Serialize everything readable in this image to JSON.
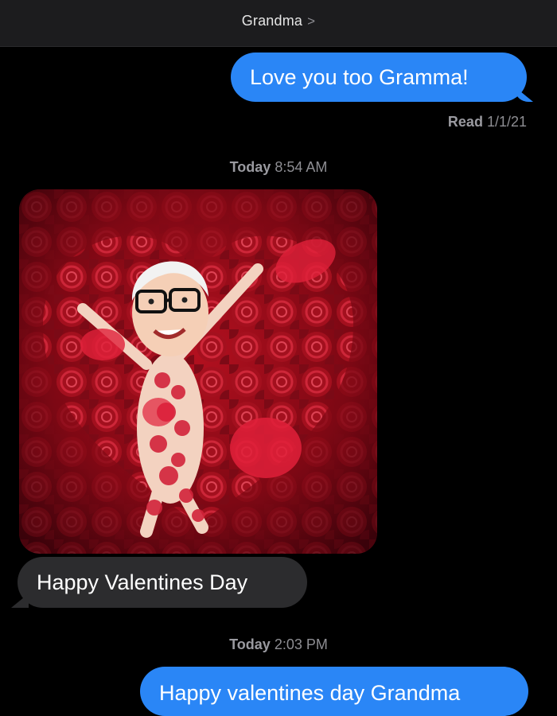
{
  "header": {
    "contact_name": "Grandma",
    "chevron_icon": "chevron-right-icon"
  },
  "messages": [
    {
      "type": "sent",
      "text": "Love you too Gramma!"
    },
    {
      "type": "status",
      "label": "Read",
      "date": "1/1/21"
    },
    {
      "type": "timestamp",
      "day": "Today",
      "time": "8:54 AM"
    },
    {
      "type": "received-image",
      "alt": ""
    },
    {
      "type": "received",
      "text": "Happy Valentines Day"
    },
    {
      "type": "timestamp",
      "day": "Today",
      "time": "2:03 PM"
    },
    {
      "type": "sent",
      "text": "Happy valentines day Grandma"
    }
  ],
  "colors": {
    "background": "#000000",
    "sent_bubble": "#2a86f6",
    "received_bubble": "#2c2c2e",
    "meta_text": "#8e8e93"
  }
}
